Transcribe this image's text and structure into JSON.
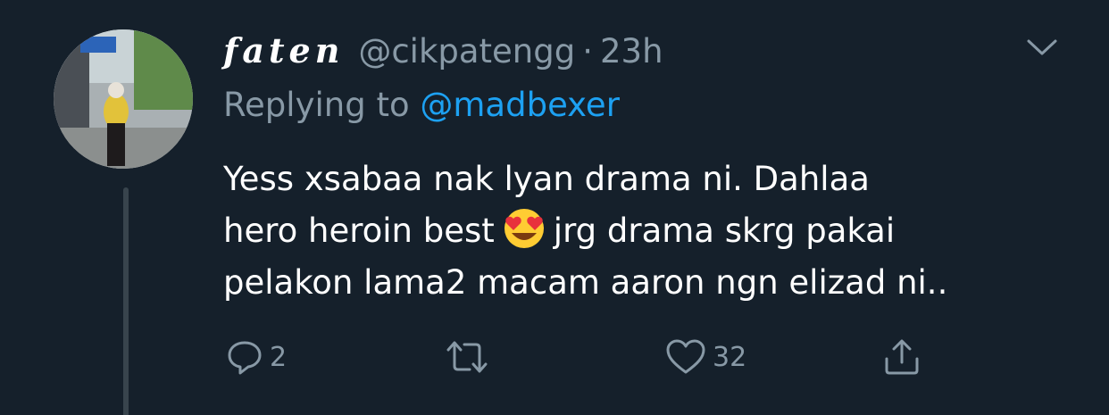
{
  "tweet": {
    "display_name": "faten",
    "handle": "@cikpatengg",
    "separator": "·",
    "time": "23h",
    "reply_prefix": "Replying to",
    "reply_mention": "@madbexer",
    "body_line1": "Yess xsabaa nak lyan drama ni. Dahlaa",
    "body_line2_before": "hero heroin best",
    "body_line2_after": "jrg drama skrg pakai",
    "body_line3": "pelakon lama2 macam aaron ngn elizad ni..",
    "emoji": "heart-eyes-emoji"
  },
  "actions": {
    "reply_count": "2",
    "retweet_count": "",
    "like_count": "32"
  },
  "icons": {
    "reply": "reply-icon",
    "retweet": "retweet-icon",
    "like": "heart-icon",
    "share": "share-icon",
    "caret": "chevron-down-icon"
  },
  "colors": {
    "background": "#15202b",
    "text_primary": "#ffffff",
    "text_secondary": "#8899a6",
    "link": "#1da1f2",
    "thread_line": "#38444d"
  }
}
